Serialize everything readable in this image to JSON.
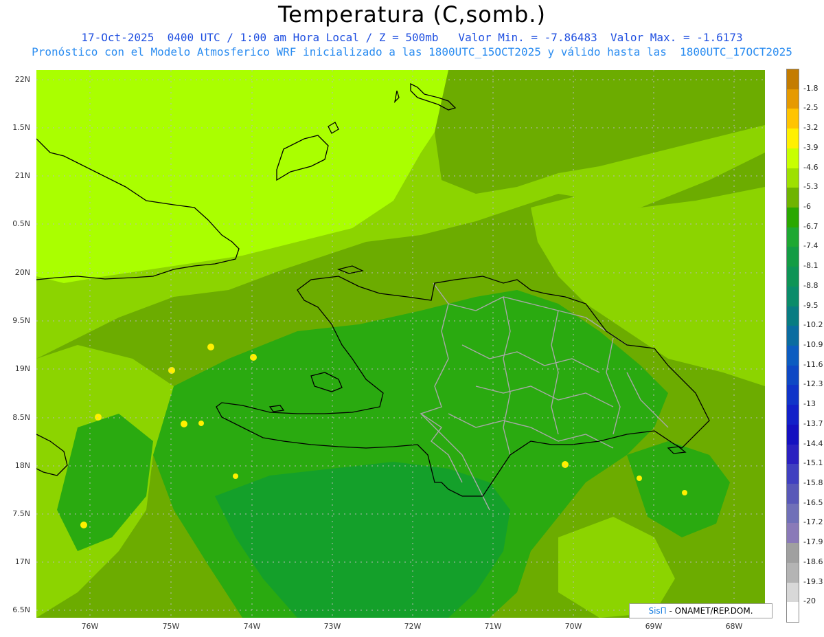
{
  "header": {
    "title": "Temperatura (C,somb.)",
    "line1": "17-Oct-2025  0400 UTC / 1:00 am Hora Local / Z = 500mb   Valor Min. = -7.86483  Valor Max. = -1.6173",
    "line2": "Pronóstico con el Modelo Atmosferico WRF inicializado a las 1800UTC_15OCT2025 y válido hasta las  1800UTC_17OCT2025"
  },
  "axes": {
    "lat_labels": [
      "22N",
      "1.5N",
      "21N",
      "0.5N",
      "20N",
      "9.5N",
      "19N",
      "8.5N",
      "18N",
      "7.5N",
      "17N",
      "6.5N"
    ],
    "lon_labels": [
      "76W",
      "75W",
      "74W",
      "73W",
      "72W",
      "71W",
      "70W",
      "69W",
      "68W"
    ]
  },
  "colorbar": {
    "labels": [
      "-1.8",
      "-2.5",
      "-3.2",
      "-3.9",
      "-4.6",
      "-5.3",
      "-6",
      "-6.7",
      "-7.4",
      "-8.1",
      "-8.8",
      "-9.5",
      "-10.2",
      "-10.9",
      "-11.6",
      "-12.3",
      "-13",
      "-13.7",
      "-14.4",
      "-15.1",
      "-15.8",
      "-16.5",
      "-17.2",
      "-17.9",
      "-18.6",
      "-19.3",
      "-20"
    ],
    "colors": [
      "#c47c00",
      "#e69a00",
      "#ffc400",
      "#fff000",
      "#c8ff00",
      "#9ee000",
      "#6fb400",
      "#2aa800",
      "#1ea832",
      "#139c44",
      "#0e9456",
      "#0a8c6a",
      "#087c82",
      "#0a6ca0",
      "#0c5cc0",
      "#0e48c4",
      "#1034c8",
      "#1220c8",
      "#1410c0",
      "#2a20c0",
      "#4040c0",
      "#5858b8",
      "#7070b8",
      "#8a7ab8",
      "#a0a0a0",
      "#b4b4b4",
      "#d8d8d8",
      "#ffffff"
    ]
  },
  "map_colors": {
    "light": "#aaff00",
    "yellowgreen": "#8cd400",
    "olive": "#6cac00",
    "green": "#2aaa10",
    "midgreen": "#14a02a",
    "coast": "#000000",
    "borders": "#a8a8a8"
  },
  "credit": {
    "brand": "SisΠ",
    "text": " -  ONAMET/REP.DOM."
  }
}
